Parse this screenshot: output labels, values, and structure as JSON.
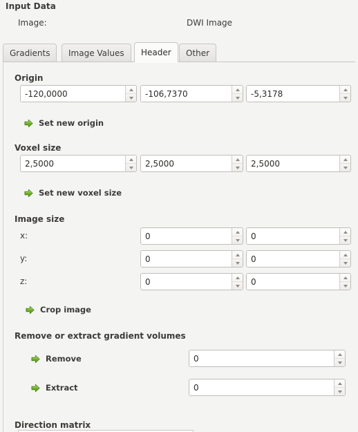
{
  "header": {
    "title": "Input Data",
    "image_label": "Image:",
    "image_value": "DWI Image"
  },
  "tabs": [
    {
      "label": "Gradients",
      "active": false
    },
    {
      "label": "Image Values",
      "active": false
    },
    {
      "label": "Header",
      "active": true
    },
    {
      "label": "Other",
      "active": false
    }
  ],
  "origin": {
    "title": "Origin",
    "values": [
      "-120,0000",
      "-106,7370",
      "-5,3178"
    ],
    "action_label": "Set new origin"
  },
  "voxel_size": {
    "title": "Voxel size",
    "values": [
      "2,5000",
      "2,5000",
      "2,5000"
    ],
    "action_label": "Set new voxel size"
  },
  "image_size": {
    "title": "Image size",
    "rows": [
      {
        "label": "x:",
        "from": "0",
        "to": "0"
      },
      {
        "label": "y:",
        "from": "0",
        "to": "0"
      },
      {
        "label": "z:",
        "from": "0",
        "to": "0"
      }
    ],
    "action_label": "Crop image"
  },
  "gradient_volumes": {
    "title": "Remove or extract gradient volumes",
    "remove_label": "Remove",
    "remove_value": "0",
    "extract_label": "Extract",
    "extract_value": "0"
  },
  "direction_matrix": {
    "title": "Direction matrix"
  },
  "colors": {
    "accent_green": "#66a81e",
    "background": "#f4f4f3",
    "text": "#3c3b37",
    "field_background": "#ffffff",
    "border": "#bfbdba"
  },
  "icons": {
    "arrow_right": "arrow-right-green-icon",
    "spin_up": "chevron-up-icon",
    "spin_down": "chevron-down-icon"
  }
}
